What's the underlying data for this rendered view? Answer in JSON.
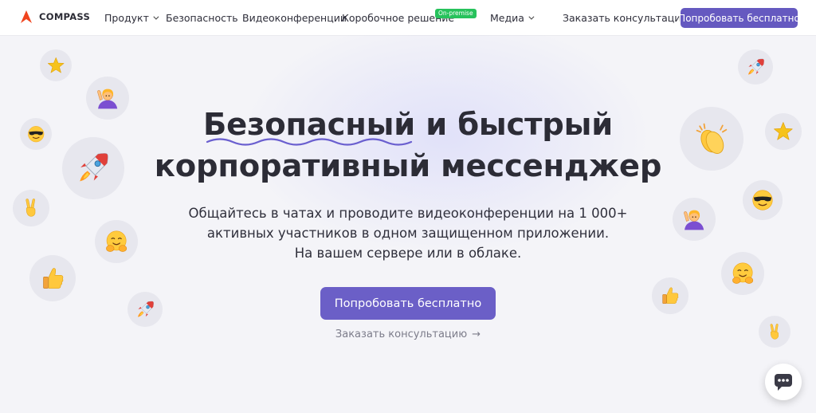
{
  "header": {
    "logo_text": "COMPASS",
    "nav": {
      "product": "Продукт",
      "security": "Безопасность",
      "video": "Видеоконференции",
      "boxed": "Коробочное решение",
      "boxed_badge": "On-premise",
      "media": "Медиа",
      "consult": "Заказать консультацию"
    },
    "cta": "Попробовать бесплатно"
  },
  "hero": {
    "title_line1_highlight": "Безопасный",
    "title_line1_rest": " и быстрый",
    "title_line2": "корпоративный мессенджер",
    "subtitle_line1": "Общайтесь в чатах и проводите видеоконференции на 1 000+",
    "subtitle_line2": "активных участников в одном защищенном приложении.",
    "subtitle_line3": "На вашем сервере или в облаке.",
    "cta": "Попробовать бесплатно",
    "secondary_link": "Заказать консультацию",
    "secondary_arrow": "→"
  },
  "colors": {
    "accent": "#6b5fc7",
    "header_cta": "#6559c0",
    "badge": "#27c25c",
    "logo": "#f0441e",
    "squiggle": "#6a5fcf",
    "background": "#f4f4f8"
  },
  "emoji_icons": [
    "star-icon",
    "raising-hand-icon",
    "sunglasses-face-icon",
    "rocket-icon",
    "victory-hand-icon",
    "hugging-face-icon",
    "thumbs-up-icon",
    "clapping-hands-icon"
  ],
  "chat_widget_icon": "chat-bubble-icon"
}
